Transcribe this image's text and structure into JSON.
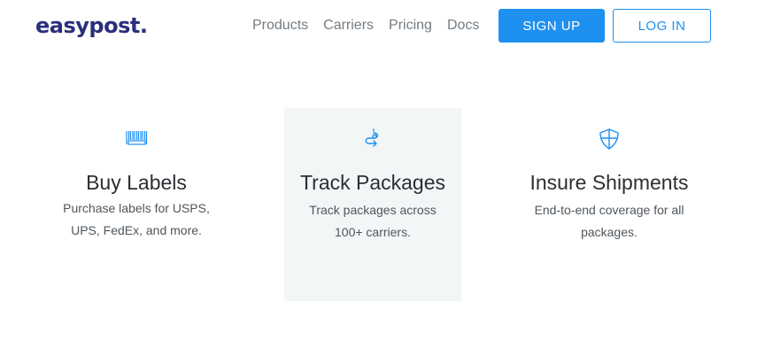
{
  "header": {
    "logo": "easypost.",
    "nav": [
      "Products",
      "Carriers",
      "Pricing",
      "Docs"
    ],
    "signup_label": "SIGN UP",
    "login_label": "LOG IN"
  },
  "colors": {
    "brand": "#2a2f7c",
    "accent": "#1e90f0",
    "highlight_bg": "#f2f6f7"
  },
  "features": [
    {
      "icon": "barcode-icon",
      "title": "Buy Labels",
      "description": "Purchase labels for USPS, UPS, FedEx, and more."
    },
    {
      "icon": "tracking-route-icon",
      "title": "Track Packages",
      "description": "Track packages across 100+ carriers."
    },
    {
      "icon": "shield-icon",
      "title": "Insure Shipments",
      "description": "End-to-end coverage for all packages."
    }
  ]
}
